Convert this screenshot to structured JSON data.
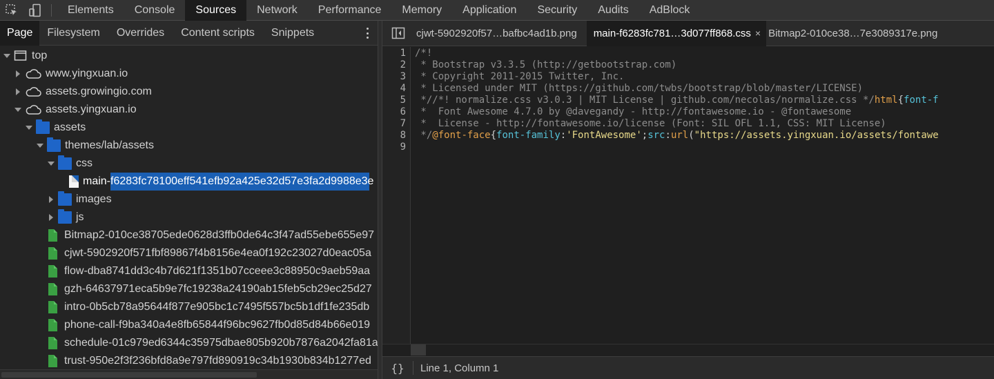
{
  "toolbar": {
    "tabs": [
      "Elements",
      "Console",
      "Sources",
      "Network",
      "Performance",
      "Memory",
      "Application",
      "Security",
      "Audits",
      "AdBlock"
    ],
    "active_index": 2
  },
  "navigator": {
    "tabs": [
      "Page",
      "Filesystem",
      "Overrides",
      "Content scripts",
      "Snippets"
    ],
    "active_index": 0,
    "tree": [
      {
        "label": "top",
        "icon": "frame-icon",
        "depth": 0,
        "expanded": true
      },
      {
        "label": "www.yingxuan.io",
        "icon": "cloud-icon",
        "depth": 1,
        "expanded": false
      },
      {
        "label": "assets.growingio.com",
        "icon": "cloud-icon",
        "depth": 1,
        "expanded": false
      },
      {
        "label": "assets.yingxuan.io",
        "icon": "cloud-icon",
        "depth": 1,
        "expanded": true
      },
      {
        "label": "assets",
        "icon": "folder-icon",
        "depth": 2,
        "expanded": true
      },
      {
        "label": "themes/lab/assets",
        "icon": "folder-icon",
        "depth": 3,
        "expanded": true
      },
      {
        "label": "css",
        "icon": "folder-icon",
        "depth": 4,
        "expanded": true
      },
      {
        "label": "main-f6283fc78100eff541efb92a425e32d57e3fa2d9988e3e",
        "icon": "css-file-icon",
        "depth": 5,
        "selected": true
      },
      {
        "label": "images",
        "icon": "folder-icon",
        "depth": 4,
        "expanded": false
      },
      {
        "label": "js",
        "icon": "folder-icon",
        "depth": 4,
        "expanded": false
      },
      {
        "label": "Bitmap2-010ce38705ede0628d3ffb0de64c3f47ad55ebe655e97",
        "icon": "image-file-icon",
        "depth": 4
      },
      {
        "label": "cjwt-5902920f571fbf89867f4b8156e4ea0f192c23027d0eac05a",
        "icon": "image-file-icon",
        "depth": 4
      },
      {
        "label": "flow-dba8741dd3c4b7d621f1351b07cceee3c88950c9aeb59aa",
        "icon": "image-file-icon",
        "depth": 4
      },
      {
        "label": "gzh-64637971eca5b9e7fc19238a24190ab15feb5cb29ec25d27",
        "icon": "image-file-icon",
        "depth": 4
      },
      {
        "label": "intro-0b5cb78a95644f877e905bc1c7495f557bc5b1df1fe235db",
        "icon": "image-file-icon",
        "depth": 4
      },
      {
        "label": "phone-call-f9ba340a4e8fb65844f96bc9627fb0d85d84b66e019",
        "icon": "image-file-icon",
        "depth": 4
      },
      {
        "label": "schedule-01c979ed6344c35975dbae805b920b7876a2042fa81a",
        "icon": "image-file-icon",
        "depth": 4
      },
      {
        "label": "trust-950e2f3f236bfd8a9e797fd890919c34b1930b834b1277ed",
        "icon": "image-file-icon",
        "depth": 4
      }
    ]
  },
  "editor": {
    "tabs": [
      {
        "label": "cjwt-5902920f57…bafbc4ad1b.png",
        "active": false
      },
      {
        "label": "main-f6283fc781…3d077ff868.css",
        "active": true,
        "close": "×"
      },
      {
        "label": "Bitmap2-010ce38…7e3089317e.png",
        "active": false
      }
    ],
    "lines": [
      {
        "n": "1",
        "tokens": [
          {
            "t": "/*!",
            "c": "cm"
          }
        ]
      },
      {
        "n": "2",
        "tokens": [
          {
            "t": " * Bootstrap v3.3.5 (http://getbootstrap.com)",
            "c": "cm"
          }
        ]
      },
      {
        "n": "3",
        "tokens": [
          {
            "t": " * Copyright 2011-2015 Twitter, Inc.",
            "c": "cm"
          }
        ]
      },
      {
        "n": "4",
        "tokens": [
          {
            "t": " * Licensed under MIT (https://github.com/twbs/bootstrap/blob/master/LICENSE)",
            "c": "cm"
          }
        ]
      },
      {
        "n": "5",
        "tokens": [
          {
            "t": " *//*! normalize.css v3.0.3 | MIT License | github.com/necolas/normalize.css */",
            "c": "cm"
          },
          {
            "t": "html",
            "c": "kw"
          },
          {
            "t": "{",
            "c": "pu"
          },
          {
            "t": "font-f",
            "c": "pr"
          }
        ]
      },
      {
        "n": "6",
        "tokens": [
          {
            "t": " *  Font Awesome 4.7.0 by @davegandy - http://fontawesome.io - @fontawesome",
            "c": "cm"
          }
        ]
      },
      {
        "n": "7",
        "tokens": [
          {
            "t": " *  License - http://fontawesome.io/license (Font: SIL OFL 1.1, CSS: MIT License)",
            "c": "cm"
          }
        ]
      },
      {
        "n": "8",
        "tokens": [
          {
            "t": " */",
            "c": "cm"
          },
          {
            "t": "@font-face",
            "c": "kw"
          },
          {
            "t": "{",
            "c": "pu"
          },
          {
            "t": "font-family",
            "c": "pr"
          },
          {
            "t": ":",
            "c": "pu"
          },
          {
            "t": "'FontAwesome'",
            "c": "st"
          },
          {
            "t": ";",
            "c": "pu"
          },
          {
            "t": "src",
            "c": "pr"
          },
          {
            "t": ":",
            "c": "pu"
          },
          {
            "t": "url",
            "c": "kw"
          },
          {
            "t": "(",
            "c": "pu"
          },
          {
            "t": "\"https://assets.yingxuan.io/assets/fontawe",
            "c": "st"
          }
        ]
      },
      {
        "n": "9",
        "tokens": []
      }
    ]
  },
  "status": {
    "braces": "{}",
    "position": "Line 1, Column 1"
  }
}
